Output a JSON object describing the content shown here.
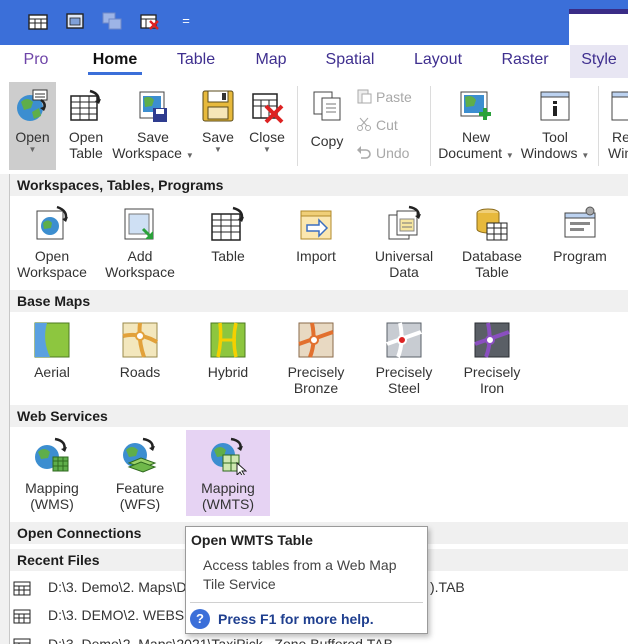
{
  "quick_access": {
    "more_glyph": "="
  },
  "tabs": [
    "Pro",
    "Home",
    "Table",
    "Map",
    "Spatial",
    "Layout",
    "Raster",
    "Style"
  ],
  "ribbon": {
    "open": "Open",
    "open_table": [
      "Open",
      "Table"
    ],
    "save_workspace": [
      "Save",
      "Workspace"
    ],
    "save": "Save",
    "close": "Close",
    "copy": "Copy",
    "paste": "Paste",
    "cut": "Cut",
    "undo": "Undo",
    "new_document": [
      "New",
      "Document"
    ],
    "tool_windows": [
      "Tool",
      "Windows"
    ],
    "clipped_button": [
      "Re",
      "Win"
    ]
  },
  "sections": {
    "workspaces": "Workspaces, Tables, Programs",
    "base_maps": "Base Maps",
    "web_services": "Web Services",
    "open_connections": "Open Connections",
    "recent_files": "Recent Files"
  },
  "workspace_items": [
    [
      "Open",
      "Workspace"
    ],
    [
      "Add",
      "Workspace"
    ],
    [
      "Table",
      ""
    ],
    [
      "Import",
      ""
    ],
    [
      "Universal",
      "Data"
    ],
    [
      "Database",
      "Table"
    ],
    [
      "Program",
      ""
    ]
  ],
  "base_map_items": [
    [
      "Aerial",
      ""
    ],
    [
      "Roads",
      ""
    ],
    [
      "Hybrid",
      ""
    ],
    [
      "Precisely",
      "Bronze"
    ],
    [
      "Precisely",
      "Steel"
    ],
    [
      "Precisely",
      "Iron"
    ]
  ],
  "web_service_items": [
    [
      "Mapping",
      "(WMS)"
    ],
    [
      "Feature",
      "(WFS)"
    ],
    [
      "Mapping",
      "(WMTS)"
    ]
  ],
  "recent_files": [
    "D:\\3. Demo\\2. Maps\\D",
    "D:\\3. DEMO\\2. WEBSE",
    "D:\\3. Demo\\2. Maps\\2021\\TaxiPick...Zone Buffered.TAB"
  ],
  "recent_hidden_suffix": ").TAB",
  "tooltip": {
    "title": "Open WMTS Table",
    "body": "Access tables from a Web Map Tile Service",
    "help": "Press F1 for more help.",
    "help_glyph": "?"
  },
  "colors": {
    "titlebar": "#3b6fd9",
    "tab_text": "#3f2f8f",
    "hover": "#e6d3f3",
    "section_bg": "#f0f0f0"
  }
}
